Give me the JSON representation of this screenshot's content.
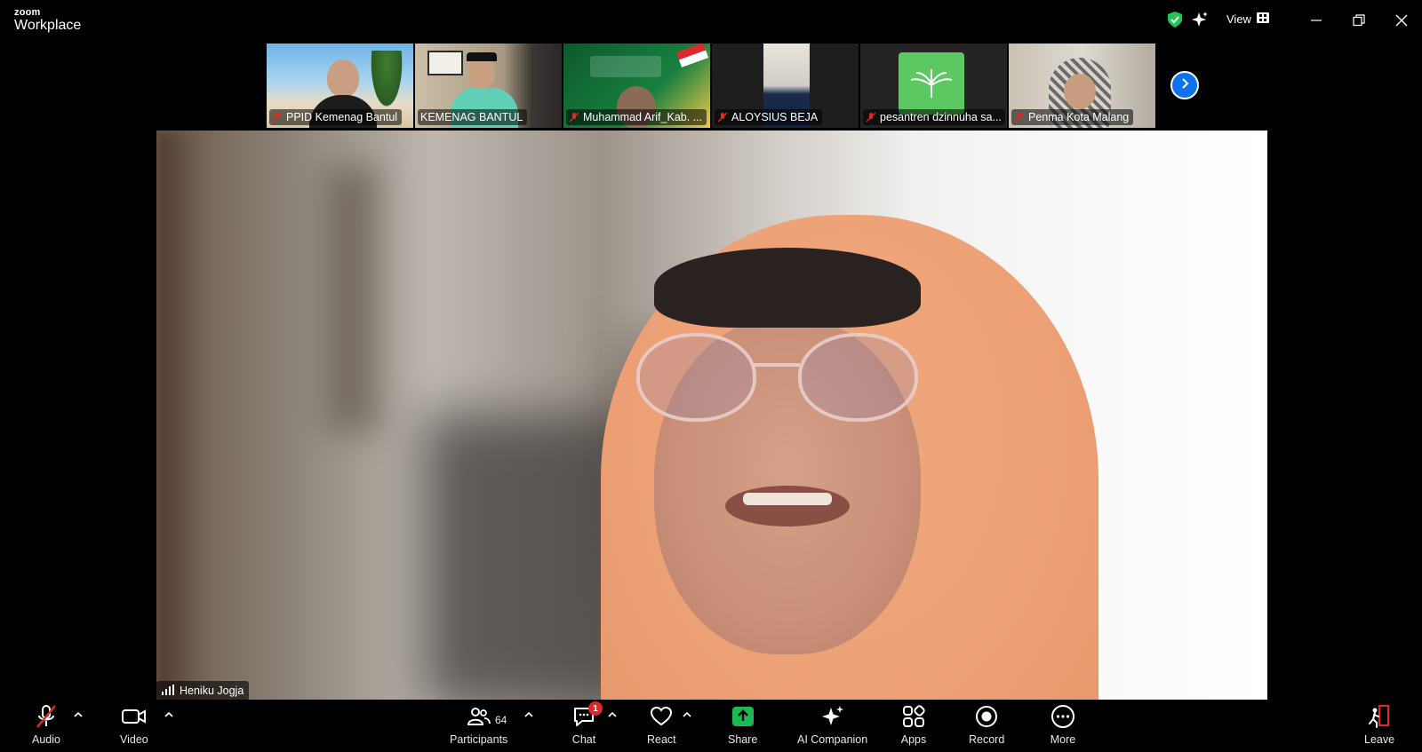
{
  "app": {
    "brand_small": "zoom",
    "brand_big": "Workplace",
    "view_label": "View"
  },
  "participants_strip": [
    {
      "name": "PPID Kemenag Bantul",
      "muted": true,
      "bg": "beach"
    },
    {
      "name": "KEMENAG BANTUL",
      "muted": false,
      "bg": "office"
    },
    {
      "name": "Muhammad Arif_Kab. ...",
      "muted": true,
      "bg": "green-banner"
    },
    {
      "name": "ALOYSIUS BEJA",
      "muted": true,
      "bg": "dark"
    },
    {
      "name": "pesantren dzinnuha sa...",
      "muted": true,
      "bg": "logo"
    },
    {
      "name": "Penma Kota Malang",
      "muted": true,
      "bg": "room"
    }
  ],
  "main_speaker": {
    "name": "Heniku Jogja"
  },
  "toolbar": {
    "audio": "Audio",
    "video": "Video",
    "participants": "Participants",
    "participants_count": "64",
    "chat": "Chat",
    "chat_badge": "1",
    "react": "React",
    "share": "Share",
    "ai_companion": "AI Companion",
    "apps": "Apps",
    "record": "Record",
    "more": "More",
    "leave": "Leave"
  },
  "colors": {
    "accent": "#0e72ed",
    "share": "#1db954",
    "shield": "#23c552",
    "danger": "#e02828"
  }
}
